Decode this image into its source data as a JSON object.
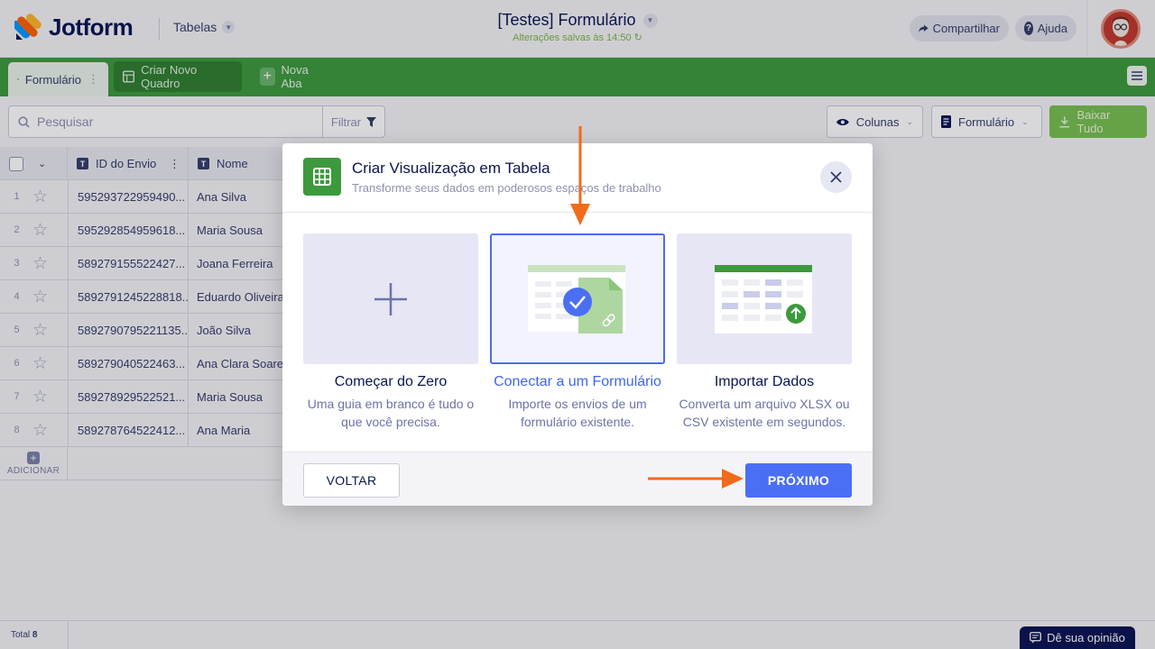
{
  "header": {
    "logo_text": "Jotform",
    "section_switch": "Tabelas",
    "doc_title": "[Testes] Formulário",
    "saved_status": "Alterações salvas às 14:50",
    "share_label": "Compartilhar",
    "help_label": "Ajuda"
  },
  "tabs": {
    "active_label": "Formulário",
    "new_board_label": "Criar Novo Quadro",
    "new_tab_label": "Nova Aba"
  },
  "toolbar": {
    "search_placeholder": "Pesquisar",
    "filter_label": "Filtrar",
    "columns_label": "Colunas",
    "form_label": "Formulário",
    "download_label": "Baixar Tudo"
  },
  "table": {
    "columns": [
      "ID do Envio",
      "Nome"
    ],
    "rows": [
      {
        "n": "1",
        "id": "595293722959490...",
        "name": "Ana Silva"
      },
      {
        "n": "2",
        "id": "595292854959618...",
        "name": "Maria Sousa"
      },
      {
        "n": "3",
        "id": "589279155522427...",
        "name": "Joana Ferreira"
      },
      {
        "n": "4",
        "id": "5892791245228818...",
        "name": "Eduardo Oliveira"
      },
      {
        "n": "5",
        "id": "5892790795221135...",
        "name": "João Silva"
      },
      {
        "n": "6",
        "id": "589279040522463...",
        "name": "Ana Clara Soares"
      },
      {
        "n": "7",
        "id": "589278929522521...",
        "name": "Maria Sousa"
      },
      {
        "n": "8",
        "id": "589278764522412...",
        "name": "Ana Maria"
      }
    ],
    "add_label": "ADICIONAR"
  },
  "footer": {
    "total_label": "Total",
    "total_value": "8",
    "feedback_label": "Dê sua opinião"
  },
  "modal": {
    "title": "Criar Visualização em Tabela",
    "subtitle": "Transforme seus dados em poderosos espaços de trabalho",
    "options": [
      {
        "title": "Começar do Zero",
        "desc": "Uma guia em branco é tudo o que você precisa."
      },
      {
        "title": "Conectar a um Formulário",
        "desc": "Importe os envios de um formulário existente."
      },
      {
        "title": "Importar Dados",
        "desc": "Converta um arquivo XLSX ou CSV existente em segundos."
      }
    ],
    "selected_index": 1,
    "back_label": "VOLTAR",
    "next_label": "PRÓXIMO"
  },
  "colors": {
    "brand_green": "#3c9a3c",
    "accent_blue": "#4a6ff5",
    "annotation_orange": "#f26a1b",
    "navy": "#0a1551"
  }
}
